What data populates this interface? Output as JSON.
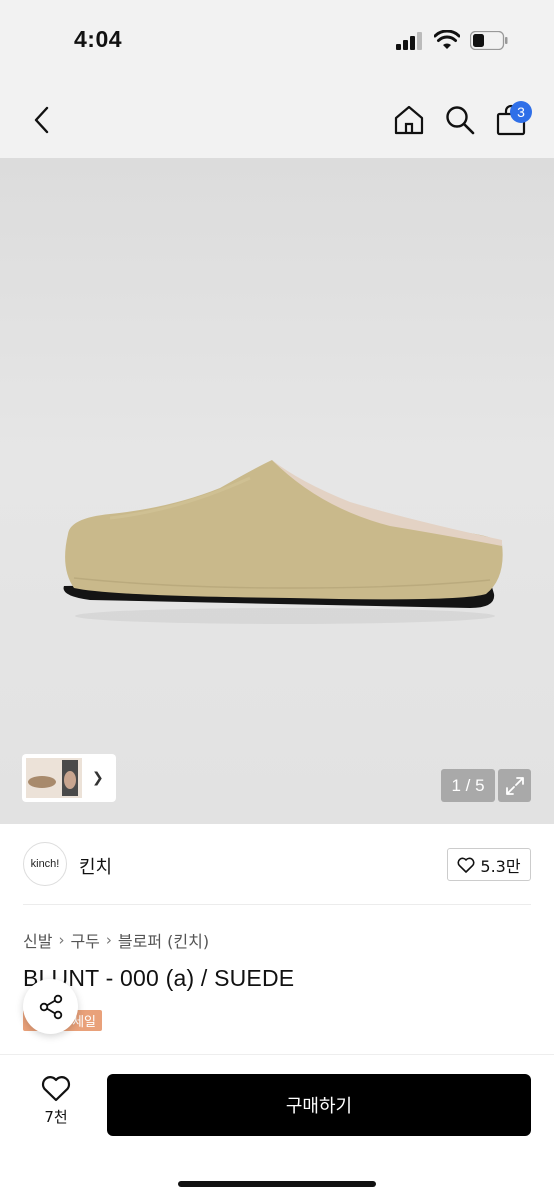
{
  "status_bar": {
    "time": "4:04"
  },
  "header": {
    "cart_count": "3"
  },
  "gallery": {
    "page_indicator": "1 / 5"
  },
  "brand": {
    "logo_text": "kinch!",
    "name": "킨치",
    "like_count": "5.3만"
  },
  "breadcrumb": {
    "items": [
      "신발",
      "구두",
      "블로퍼 (킨치)"
    ]
  },
  "product": {
    "title": "BLUNT - 000 (a) / SUEDE",
    "badge": "세일"
  },
  "bottom_bar": {
    "wish_count": "7천",
    "buy_label": "구매하기"
  },
  "colors": {
    "accent_badge": "#2f6fe8",
    "sale_badge": "#e9a17a",
    "buy_button": "#000000"
  }
}
